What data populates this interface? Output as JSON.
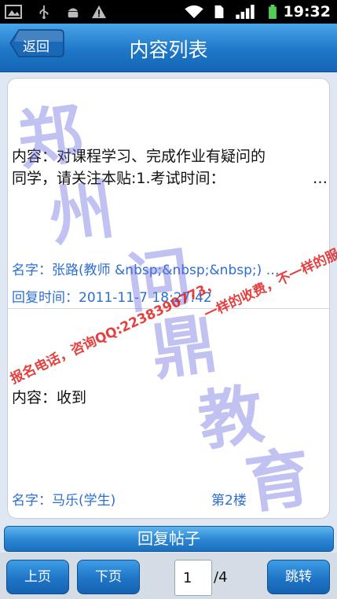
{
  "status_bar": {
    "time": "19:32",
    "icons": [
      "gallery-icon",
      "usb-icon",
      "android-debug-icon",
      "warning-icon",
      "wifi-icon",
      "sim-icon",
      "signal-icon",
      "battery-icon"
    ]
  },
  "header": {
    "back_label": "返回",
    "title": "内容列表"
  },
  "posts": [
    {
      "content": "内容：对课程学习、完成作业有疑问的",
      "content_line2": "同学，请关注本贴:1.考试时间：",
      "ellipsis": "…",
      "author": "名字：张路(教师 &nbsp;&nbsp;&nbsp;)  …",
      "reply_time": "回复时间：2011-11-7 18:27:42"
    },
    {
      "content": "内容：收到",
      "author": "名字：马乐(学生)",
      "floor": "第2楼"
    }
  ],
  "watermark": {
    "chars": [
      "郑",
      "州",
      "问",
      "鼎",
      "教",
      "育"
    ],
    "red_line1": "报名电话，咨询QQ:2238390773，",
    "red_line2": "一样的收费，不一样的服务！"
  },
  "reply_label": "回复帖子",
  "pager": {
    "prev_label": "上页",
    "next_label": "下页",
    "current_page": "1",
    "total": "/4",
    "go_label": "跳转"
  },
  "colors": {
    "accent": "#1f77c8",
    "link": "#2c6fd0",
    "watermark_red": "#e11e1e",
    "watermark_blue": "#6e6ee1"
  }
}
